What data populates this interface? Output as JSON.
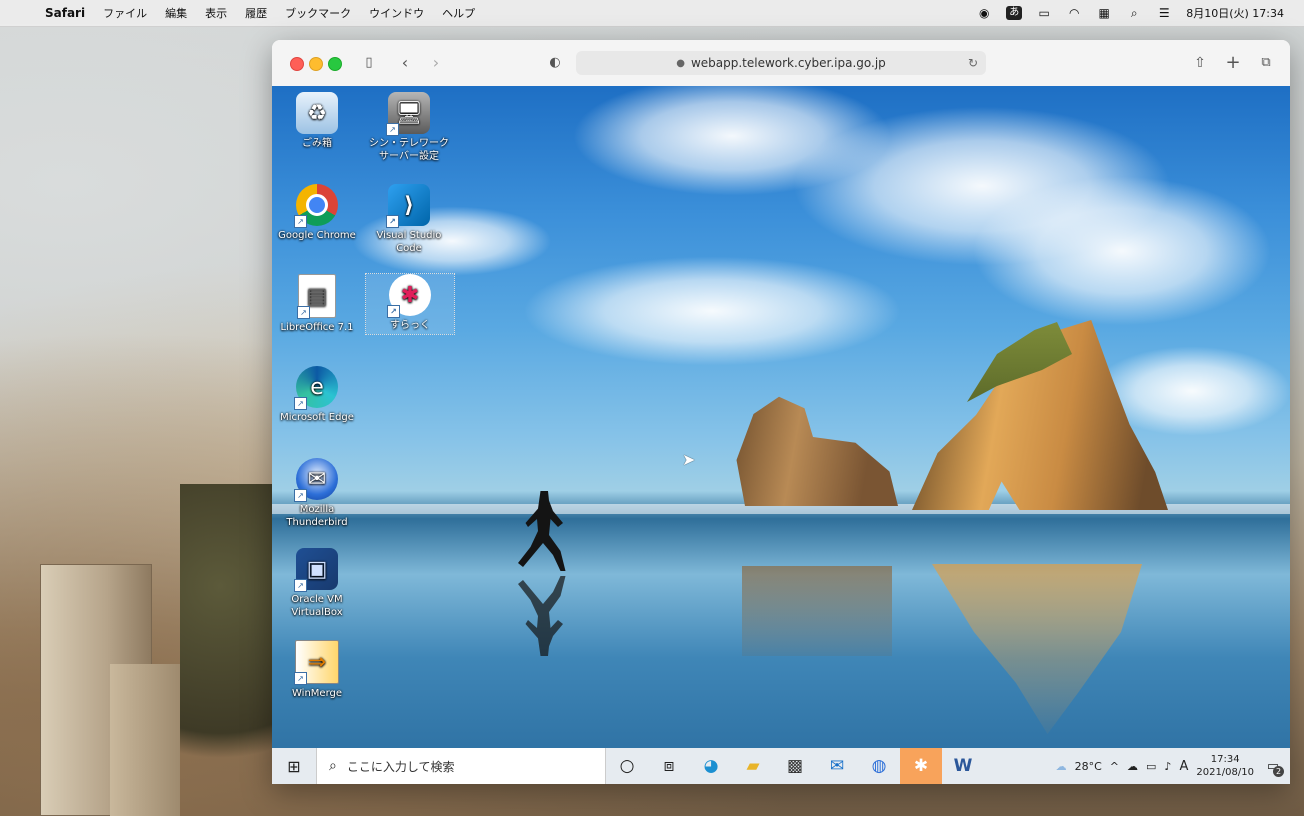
{
  "menubar": {
    "app": "Safari",
    "items": [
      "ファイル",
      "編集",
      "表示",
      "履歴",
      "ブックマーク",
      "ウインドウ",
      "ヘルプ"
    ],
    "ime": "あ",
    "datetime": "8月10日(火)  17:34"
  },
  "browser": {
    "url": "webapp.telework.cyber.ipa.go.jp"
  },
  "desktop_icons": [
    {
      "label": "ごみ箱",
      "icon": "recycle-bin-icon"
    },
    {
      "label": "シン・テレワーク サーバー設定",
      "icon": "server-settings-icon"
    },
    {
      "label": "Google Chrome",
      "icon": "chrome-icon"
    },
    {
      "label": "Visual Studio Code",
      "icon": "vscode-icon"
    },
    {
      "label": "LibreOffice 7.1",
      "icon": "libreoffice-icon"
    },
    {
      "label": "すらっく",
      "icon": "slack-icon"
    },
    {
      "label": "Microsoft Edge",
      "icon": "edge-icon"
    },
    {
      "label": "Mozilla Thunderbird",
      "icon": "thunderbird-icon"
    },
    {
      "label": "Oracle VM VirtualBox",
      "icon": "virtualbox-icon"
    },
    {
      "label": "WinMerge",
      "icon": "winmerge-icon"
    }
  ],
  "taskbar": {
    "search_placeholder": "ここに入力して検索",
    "weather": "28°C",
    "ime_mode": "A",
    "time": "17:34",
    "date": "2021/08/10",
    "notifications": "2"
  },
  "colors": {
    "taskbar_bg": "#e6ebf0",
    "active_app": "#f8a35b",
    "close": "#fe5f57",
    "minimize": "#febc2e",
    "zoom": "#28c840"
  }
}
